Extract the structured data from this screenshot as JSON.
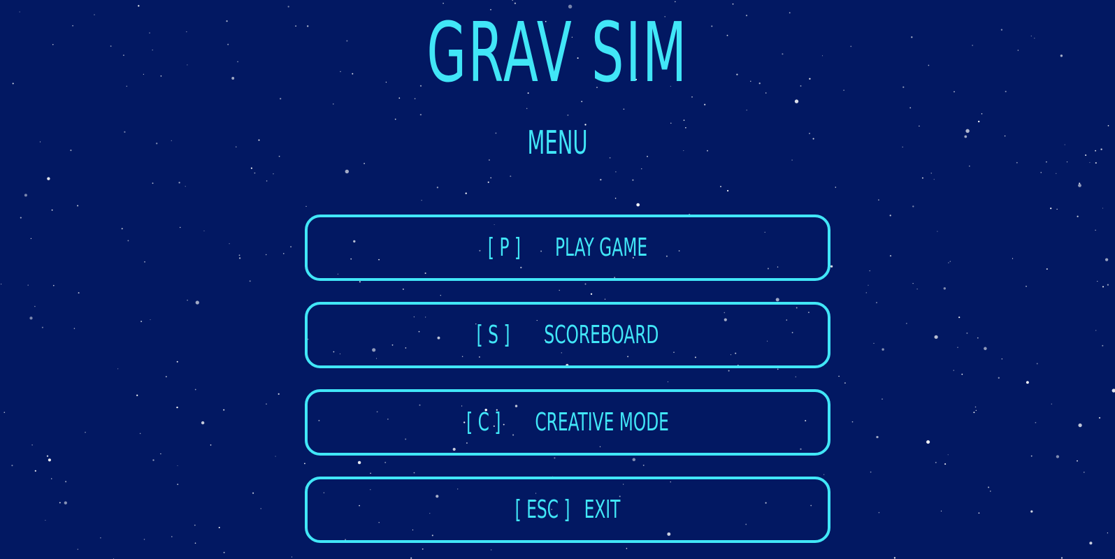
{
  "title": "GRAV SIM",
  "menu_heading": "MENU",
  "menu_items": [
    {
      "key": "[ P ]",
      "label": "PLAY GAME"
    },
    {
      "key": "[ S ]",
      "label": "SCOREBOARD"
    },
    {
      "key": "[ C ]",
      "label": "CREATIVE MODE"
    },
    {
      "key": "[ ESC ]",
      "label": "EXIT"
    }
  ],
  "colors": {
    "background": "#021862",
    "accent": "#41e6f7",
    "star": "#ffffff"
  }
}
